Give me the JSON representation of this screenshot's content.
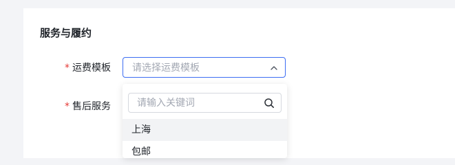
{
  "section": {
    "title": "服务与履约"
  },
  "form": {
    "required_mark": "*",
    "shipping_template": {
      "label": "运费模板",
      "placeholder": "请选择运费模板"
    },
    "after_sales": {
      "label": "售后服务"
    }
  },
  "dropdown": {
    "search_placeholder": "请输入关键词",
    "options": [
      {
        "label": "上海",
        "hovered": true
      },
      {
        "label": "包邮",
        "hovered": false
      }
    ]
  },
  "icons": {
    "select_chevron": "chevron-up-icon",
    "search": "search-icon"
  },
  "colors": {
    "accent": "#3b6cf2",
    "required": "#e53935",
    "placeholder": "#a3a8b3",
    "text": "#1f2329",
    "hover_bg": "#f2f3f5"
  }
}
